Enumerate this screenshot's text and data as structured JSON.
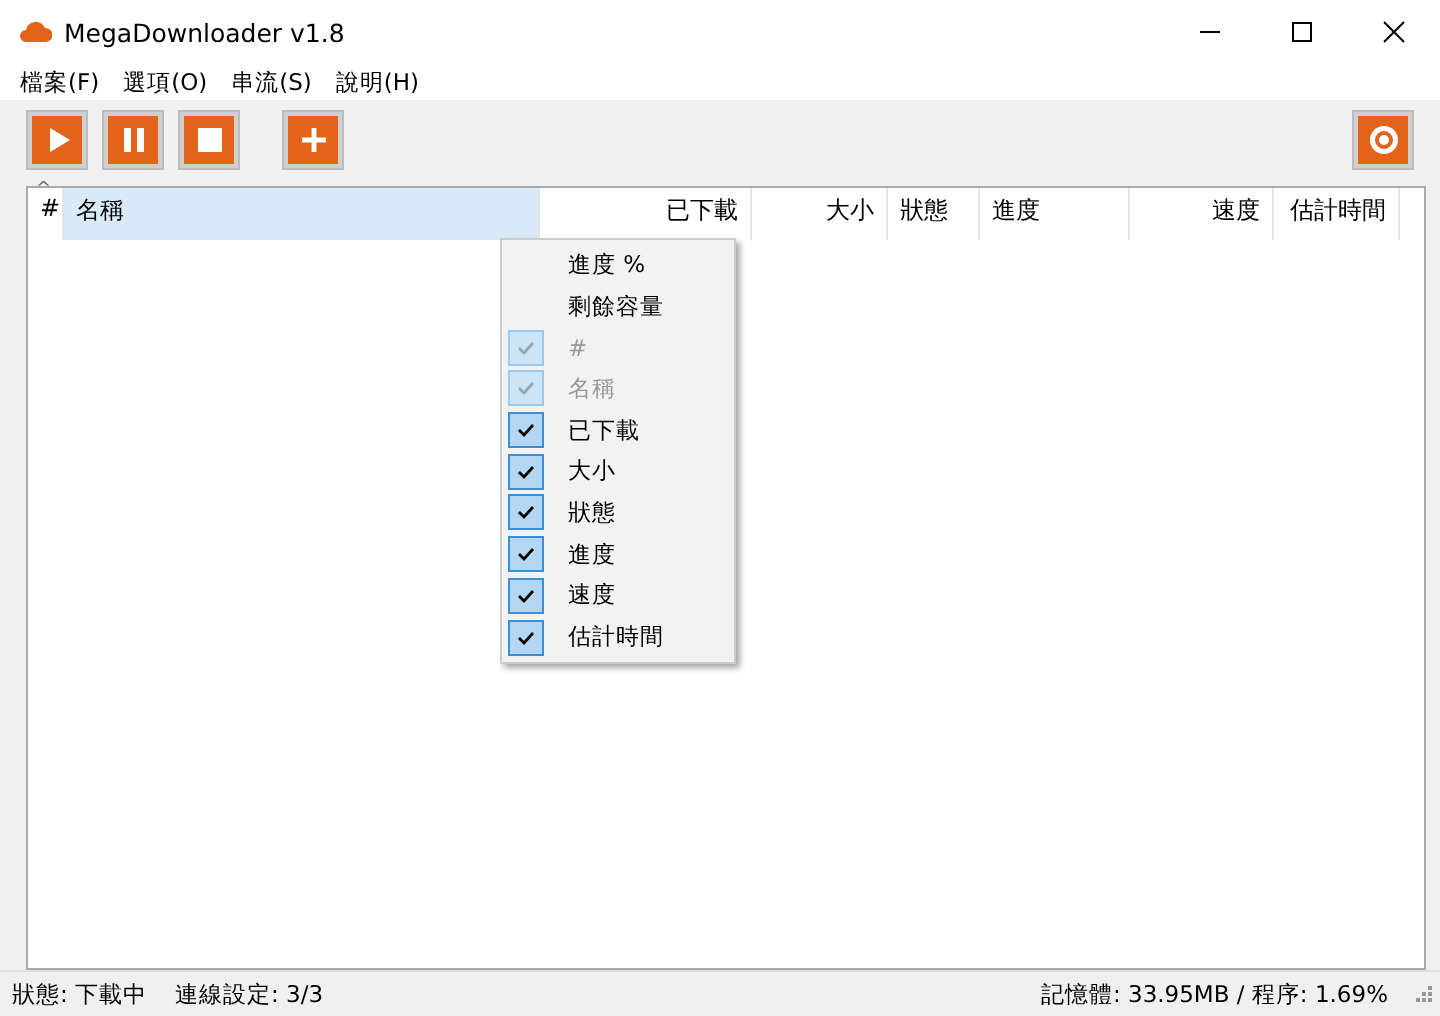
{
  "window": {
    "title": "MegaDownloader v1.8"
  },
  "menu_bar": [
    "檔案(F)",
    "選項(O)",
    "串流(S)",
    "說明(H)"
  ],
  "table": {
    "sort_indicator": "^",
    "columns": [
      {
        "label": "#",
        "selected": false
      },
      {
        "label": "名稱",
        "selected": true
      },
      {
        "label": "已下載",
        "selected": false
      },
      {
        "label": "大小",
        "selected": false
      },
      {
        "label": "狀態",
        "selected": false
      },
      {
        "label": "進度",
        "selected": false
      },
      {
        "label": "速度",
        "selected": false
      },
      {
        "label": "估計時間",
        "selected": false
      }
    ]
  },
  "context_menu": [
    {
      "label": "進度 %",
      "checked": false,
      "disabled": false
    },
    {
      "label": "剩餘容量",
      "checked": false,
      "disabled": false
    },
    {
      "label": "#",
      "checked": true,
      "disabled": true
    },
    {
      "label": "名稱",
      "checked": true,
      "disabled": true
    },
    {
      "label": "已下載",
      "checked": true,
      "disabled": false
    },
    {
      "label": "大小",
      "checked": true,
      "disabled": false
    },
    {
      "label": "狀態",
      "checked": true,
      "disabled": false
    },
    {
      "label": "進度",
      "checked": true,
      "disabled": false
    },
    {
      "label": "速度",
      "checked": true,
      "disabled": false
    },
    {
      "label": "估計時間",
      "checked": true,
      "disabled": false
    }
  ],
  "status_bar": {
    "left": [
      "狀態: 下載中",
      "連線設定: 3/3"
    ],
    "right": "記憶體: 33.95MB / 程序: 1.69%"
  }
}
